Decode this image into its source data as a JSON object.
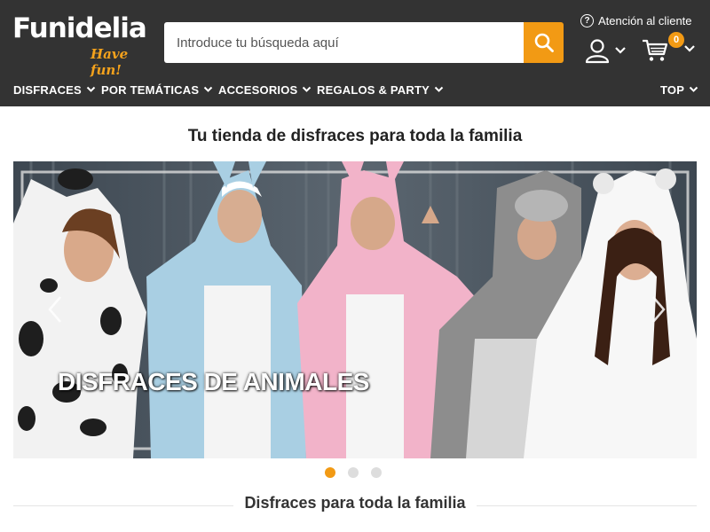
{
  "header": {
    "logo_text": "Funidelia",
    "logo_tagline": "Have fun!",
    "search_placeholder": "Introduce tu búsqueda aquí",
    "help_label": "Atención al cliente",
    "cart_count": "0",
    "colors": {
      "header_bg": "#333333",
      "accent": "#f29a14"
    }
  },
  "nav": {
    "items": [
      {
        "label": "DISFRACES"
      },
      {
        "label": "POR TEMÁTICAS"
      },
      {
        "label": "ACCESORIOS"
      },
      {
        "label": "REGALOS & PARTY"
      },
      {
        "label": "TOP"
      }
    ]
  },
  "main": {
    "heading": "Tu tienda de disfraces para toda la familia",
    "banner": {
      "caption": "DISFRACES DE ANIMALES",
      "slide_count": 3,
      "active_slide": 1
    },
    "section_title": "Disfraces para toda la familia"
  },
  "icons": {
    "search": "search-icon",
    "help": "help-icon",
    "account": "user-icon",
    "cart": "cart-icon",
    "chevron": "chevron-down-icon",
    "prev": "chevron-left-icon",
    "next": "chevron-right-icon"
  }
}
